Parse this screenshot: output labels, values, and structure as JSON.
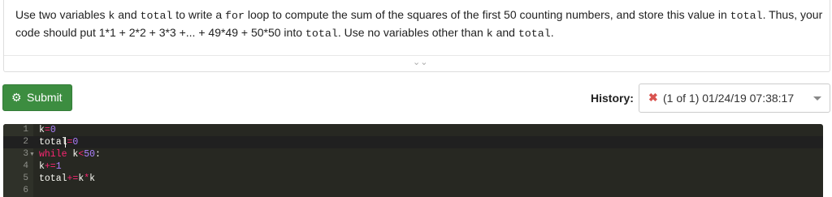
{
  "question": {
    "p1": "Use two variables ",
    "c1": "k",
    "p2": " and ",
    "c2": "total",
    "p3": " to write a ",
    "c3": "for",
    "p4": " loop to compute the sum of the squares of the first 50 counting numbers, and store this value in ",
    "c4": "total",
    "p5": ". Thus, your code should put 1*1 + 2*2 + 3*3 +... + 49*49 + 50*50 into ",
    "c5": "total",
    "p6": ". Use no variables other than ",
    "c6": "k",
    "p7": " and ",
    "c7": "total",
    "p8": "."
  },
  "toolbar": {
    "submit_label": "Submit",
    "history_label": "History:",
    "history_value": "(1 of 1) 01/24/19 07:38:17"
  },
  "editor": {
    "line_numbers": [
      "1",
      "2",
      "3",
      "4",
      "5",
      "6"
    ],
    "lines": [
      {
        "var": "k",
        "op": "=",
        "num": "0"
      },
      {
        "var": "total",
        "op": "=",
        "num": "0"
      },
      {
        "kw": "while",
        "sp": " ",
        "var": "k",
        "op": "<",
        "num": "50",
        "end": ":"
      },
      {
        "var": "k",
        "op": "+=",
        "num": "1"
      },
      {
        "var": "total",
        "op": "+=",
        "a": "k",
        "op2": "*",
        "b": "k"
      },
      {}
    ]
  },
  "colors": {
    "submit": "#3c8d40",
    "editor_bg": "#272822",
    "keyword": "#f92672",
    "number": "#ae81ff",
    "error_x": "#d9534f"
  },
  "icons": [
    "double-chevron-down-icon",
    "gear-icon",
    "x-icon",
    "caret-down-icon",
    "fold-arrow-icon"
  ]
}
